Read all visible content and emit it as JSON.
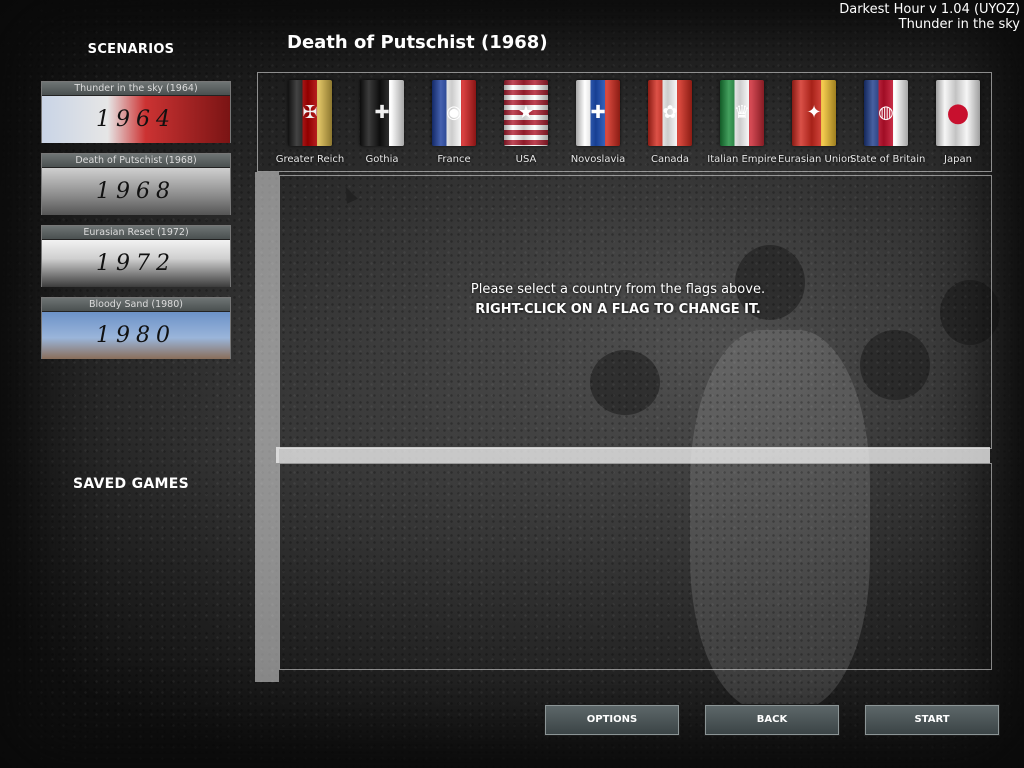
{
  "app": {
    "version": "Darkest Hour v 1.04 (UYOZ)",
    "active_scenario": "Thunder in the sky"
  },
  "sidebar": {
    "scenarios_title": "SCENARIOS",
    "saved_games_title": "SAVED GAMES",
    "scenarios": [
      {
        "label": "Thunder in the sky (1964)",
        "year_art": "1964"
      },
      {
        "label": "Death of Putschist (1968)",
        "year_art": "1968"
      },
      {
        "label": "Eurasian Reset (1972)",
        "year_art": "1972"
      },
      {
        "label": "Bloody Sand (1980)",
        "year_art": "1980"
      }
    ]
  },
  "main": {
    "title": "Death of Putschist (1968)",
    "flags": [
      {
        "name": "Greater Reich",
        "colors": [
          "#1a1a1a",
          "#b30000",
          "#d9b84a"
        ],
        "emblem": "eagle-icon"
      },
      {
        "name": "Gothia",
        "colors": [
          "#111111",
          "#111111",
          "#ffffff"
        ],
        "emblem": "cross-icon"
      },
      {
        "name": "France",
        "colors": [
          "#1d3f9e",
          "#ffffff",
          "#d42020"
        ],
        "emblem": "roundel-icon"
      },
      {
        "name": "USA",
        "colors": [
          "#b22234",
          "#ffffff",
          "#3c3b6e"
        ],
        "emblem": "stars-icon"
      },
      {
        "name": "Novoslavia",
        "colors": [
          "#ffffff",
          "#1c4fb8",
          "#d52b1e"
        ],
        "emblem": "cross-icon"
      },
      {
        "name": "Canada",
        "colors": [
          "#d52b1e",
          "#ffffff",
          "#d52b1e"
        ],
        "emblem": "leaf-icon"
      },
      {
        "name": "Italian Empire",
        "colors": [
          "#1a8a3a",
          "#ffffff",
          "#ce2b37"
        ],
        "emblem": "crest-icon"
      },
      {
        "name": "Eurasian Union",
        "colors": [
          "#d12a1f",
          "#d12a1f",
          "#f2c230"
        ],
        "emblem": "star-icon"
      },
      {
        "name": "State of Britain",
        "colors": [
          "#1f3d8c",
          "#c8102e",
          "#ffffff"
        ],
        "emblem": "circle-icon"
      },
      {
        "name": "Japan",
        "colors": [
          "#f4f4f4",
          "#f4f4f4",
          "#c8102e"
        ],
        "emblem": "sun-icon"
      }
    ],
    "message_line1": "Please select a country from the flags above.",
    "message_line2": "RIGHT-CLICK ON A FLAG TO CHANGE IT."
  },
  "footer": {
    "options_label": "OPTIONS",
    "back_label": "BACK",
    "start_label": "START"
  }
}
